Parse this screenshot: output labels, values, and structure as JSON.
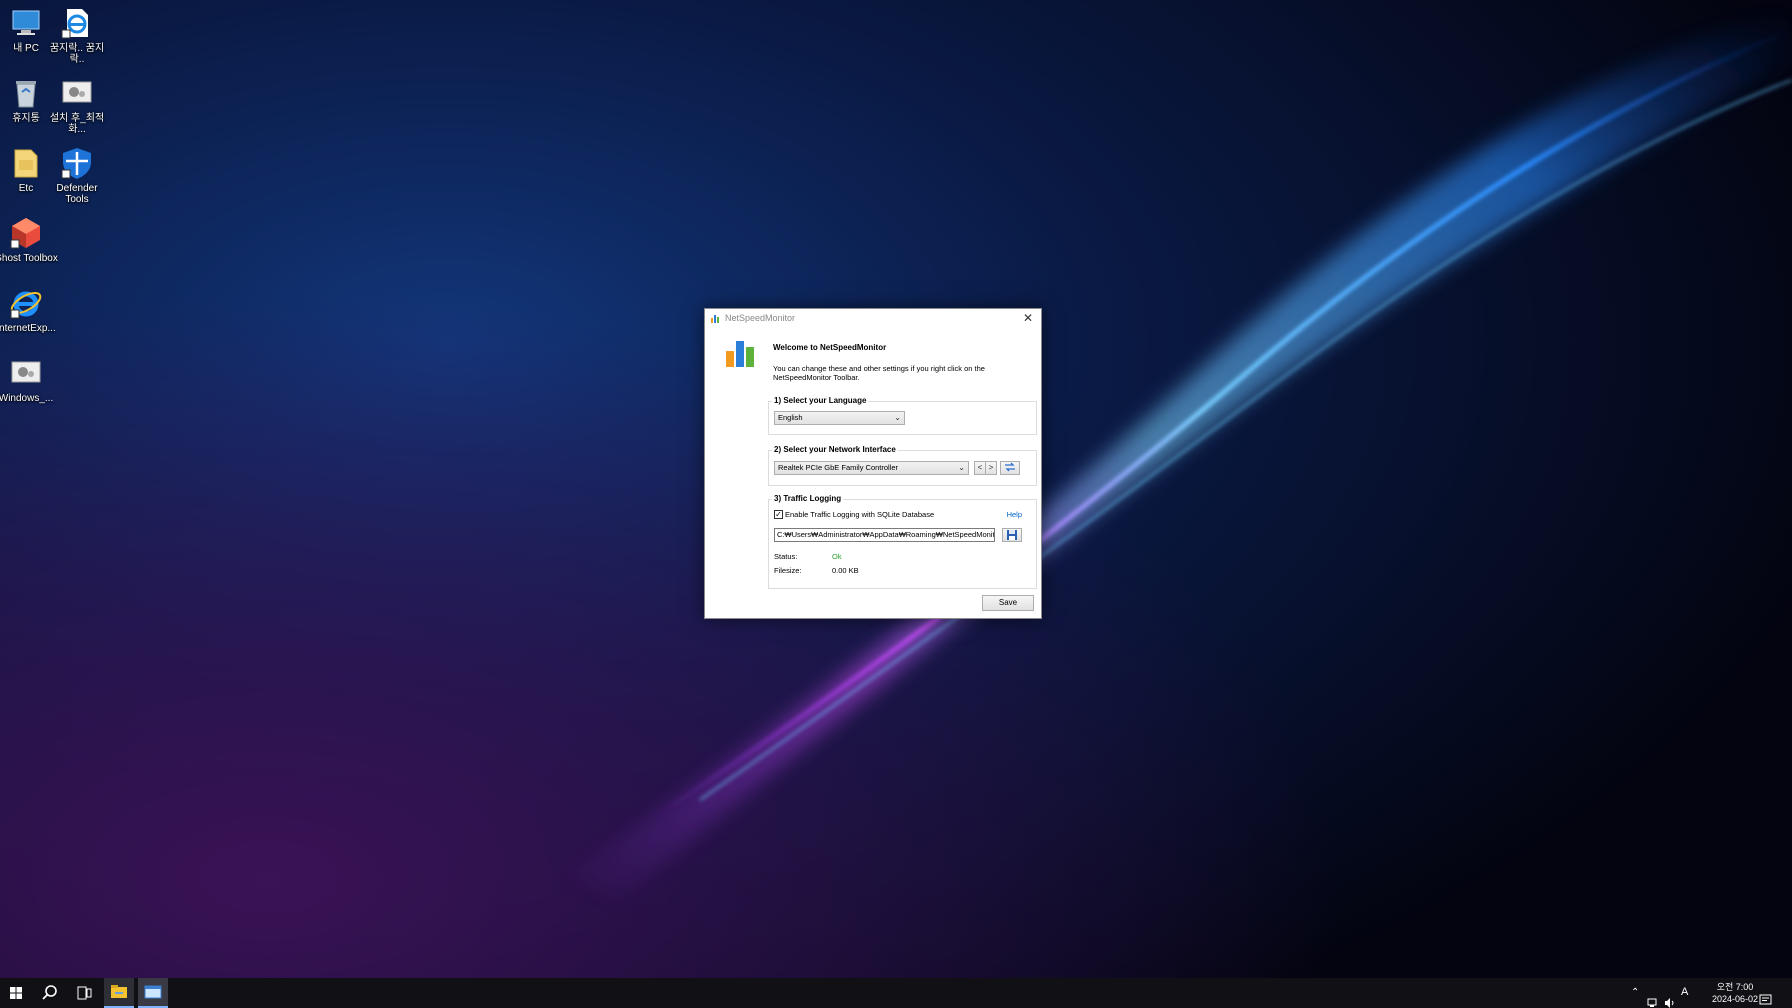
{
  "desktop": {
    "icons": [
      {
        "label": "내 PC",
        "icon": "computer-icon"
      },
      {
        "label": "꿈지락.. 꿈지락..",
        "icon": "internet-shortcut-icon"
      },
      {
        "label": "휴지통",
        "icon": "recycle-bin-icon"
      },
      {
        "label": "설치 후_최적화...",
        "icon": "settings-shortcut-icon"
      },
      {
        "label": "Etc",
        "icon": "folder-icon"
      },
      {
        "label": "Defender Tools",
        "icon": "shield-icon"
      },
      {
        "label": "Ghost Toolbox",
        "icon": "ghost-toolbox-icon"
      },
      {
        "label": "InternetExp...",
        "icon": "internet-explorer-icon"
      },
      {
        "label": "Windows_...",
        "icon": "settings-shortcut-icon"
      }
    ]
  },
  "dialog": {
    "title": "NetSpeedMonitor",
    "close_glyph": "✕",
    "welcome": "Welcome to NetSpeedMonitor",
    "intro": "You can change these and other settings if you right click on the NetSpeedMonitor Toolbar.",
    "language": {
      "heading": "1) Select your Language",
      "selected": "English"
    },
    "network": {
      "heading": "2) Select your Network Interface",
      "selected": "Realtek PCIe GbE Family Controller",
      "prev": "<",
      "next": ">"
    },
    "logging": {
      "heading": "3) Traffic Logging",
      "checkbox_label": "Enable Traffic Logging with SQLite Database",
      "checked": true,
      "help": "Help",
      "path": "C:₩Users₩Administrator₩AppData₩Roaming₩NetSpeedMonitor",
      "status_label": "Status:",
      "status_value": "Ok",
      "filesize_label": "Filesize:",
      "filesize_value": "0.00 KB"
    },
    "save": "Save"
  },
  "taskbar": {
    "clock_time": "오전 7:00",
    "clock_date": "2024-06-02",
    "ime": "A"
  },
  "colors": {
    "status_ok": "#2a9d2a",
    "link": "#0066cc",
    "taskbar": "#101015"
  }
}
